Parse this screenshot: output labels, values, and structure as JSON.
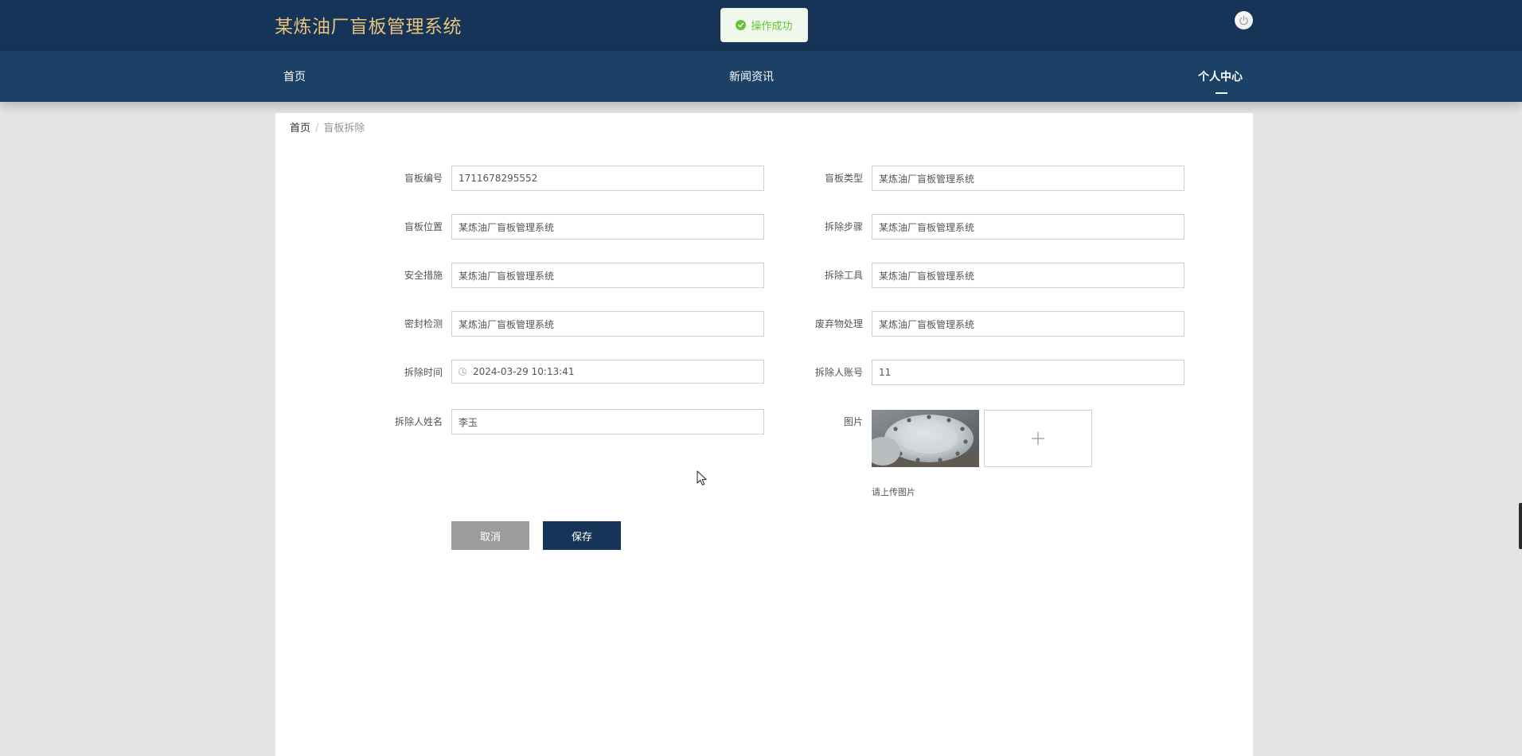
{
  "header": {
    "title": "某炼油厂盲板管理系统",
    "power_icon": "power-icon"
  },
  "toast": {
    "icon": "check-circle-icon",
    "text": "操作成功",
    "color": "#67c23a"
  },
  "nav": {
    "home": "首页",
    "news": "新闻资讯",
    "user_center": "个人中心",
    "active": "个人中心"
  },
  "breadcrumb": {
    "home": "首页",
    "separator": "/",
    "current": "盲板拆除"
  },
  "form": {
    "fields": {
      "board_no": {
        "label": "盲板编号",
        "value": "1711678295552"
      },
      "board_type": {
        "label": "盲板类型",
        "value": "某炼油厂盲板管理系统"
      },
      "board_position": {
        "label": "盲板位置",
        "value": "某炼油厂盲板管理系统"
      },
      "removal_steps": {
        "label": "拆除步骤",
        "value": "某炼油厂盲板管理系统"
      },
      "safety_measures": {
        "label": "安全措施",
        "value": "某炼油厂盲板管理系统"
      },
      "removal_tools": {
        "label": "拆除工具",
        "value": "某炼油厂盲板管理系统"
      },
      "seal_check": {
        "label": "密封检测",
        "value": "某炼油厂盲板管理系统"
      },
      "waste_disposal": {
        "label": "废弃物处理",
        "value": "某炼油厂盲板管理系统"
      },
      "removal_time": {
        "label": "拆除时间",
        "value": "2024-03-29 10:13:41"
      },
      "remover_account": {
        "label": "拆除人账号",
        "value": "11"
      },
      "remover_name": {
        "label": "拆除人姓名",
        "value": "李玉"
      }
    },
    "image": {
      "label": "图片",
      "upload_tip": "请上传图片",
      "uploader_icon": "plus-icon"
    },
    "buttons": {
      "cancel": "取消",
      "save": "保存"
    }
  },
  "colors": {
    "header_bg": "#163457",
    "nav_bg": "#1c4166",
    "title": "#e7c27c",
    "save_button": "#163457",
    "cancel_button": "#9c9c9c"
  }
}
